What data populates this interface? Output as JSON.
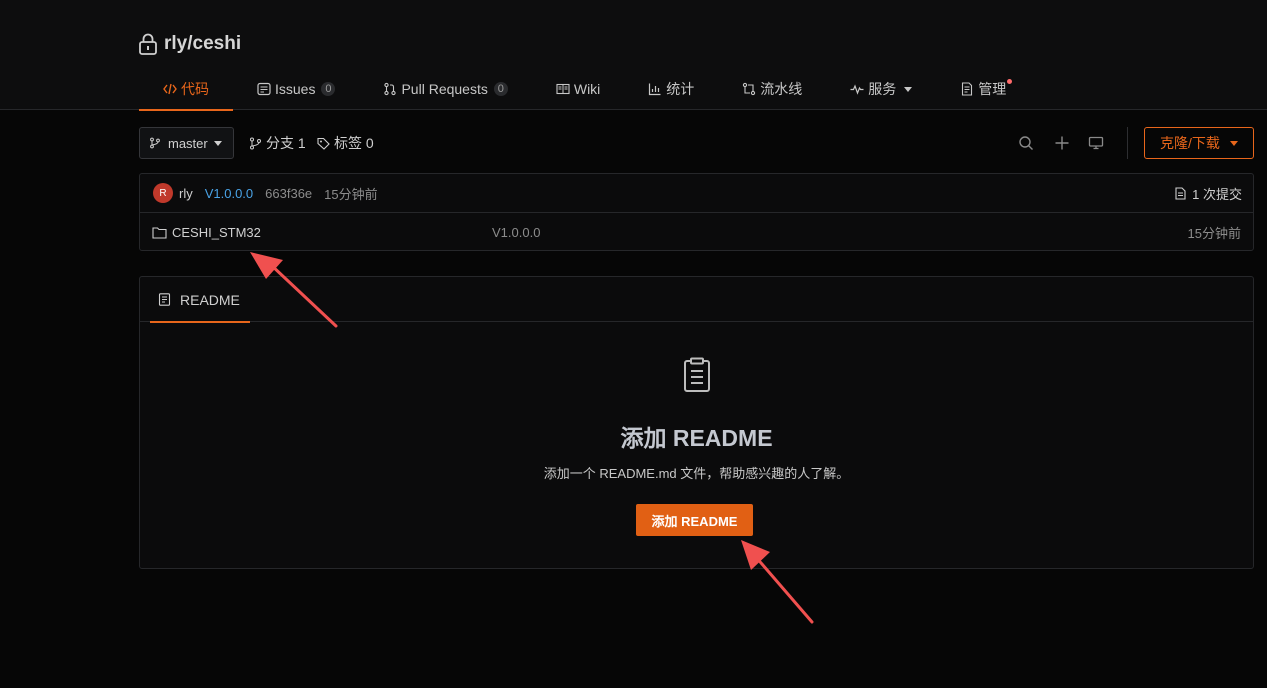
{
  "repo": {
    "name": "rly/ceshi"
  },
  "tabs": [
    {
      "label": "代码",
      "count": null
    },
    {
      "label": "Issues",
      "count": "0"
    },
    {
      "label": "Pull Requests",
      "count": "0"
    },
    {
      "label": "Wiki",
      "count": null
    },
    {
      "label": "统计",
      "count": null
    },
    {
      "label": "流水线",
      "count": null
    },
    {
      "label": "服务",
      "count": null
    },
    {
      "label": "管理",
      "count": null
    }
  ],
  "toolbar": {
    "branch": "master",
    "branches_label": "分支 1",
    "tags_label": "标签 0",
    "clone_label": "克隆/下载"
  },
  "commit": {
    "avatar_letter": "R",
    "author": "rly",
    "version": "V1.0.0.0",
    "sha": "663f36e",
    "time": "15分钟前",
    "commit_count": "1 次提交"
  },
  "files": [
    {
      "name": "CESHI_STM32",
      "message": "V1.0.0.0",
      "time": "15分钟前"
    }
  ],
  "readme": {
    "tab_label": "README",
    "empty_title": "添加 README",
    "empty_desc": "添加一个 README.md 文件，帮助感兴趣的人了解。",
    "add_button": "添加 README"
  },
  "colors": {
    "accent": "#e8661b",
    "link": "#4aa3e6",
    "annotation_arrow": "#f0504f"
  }
}
